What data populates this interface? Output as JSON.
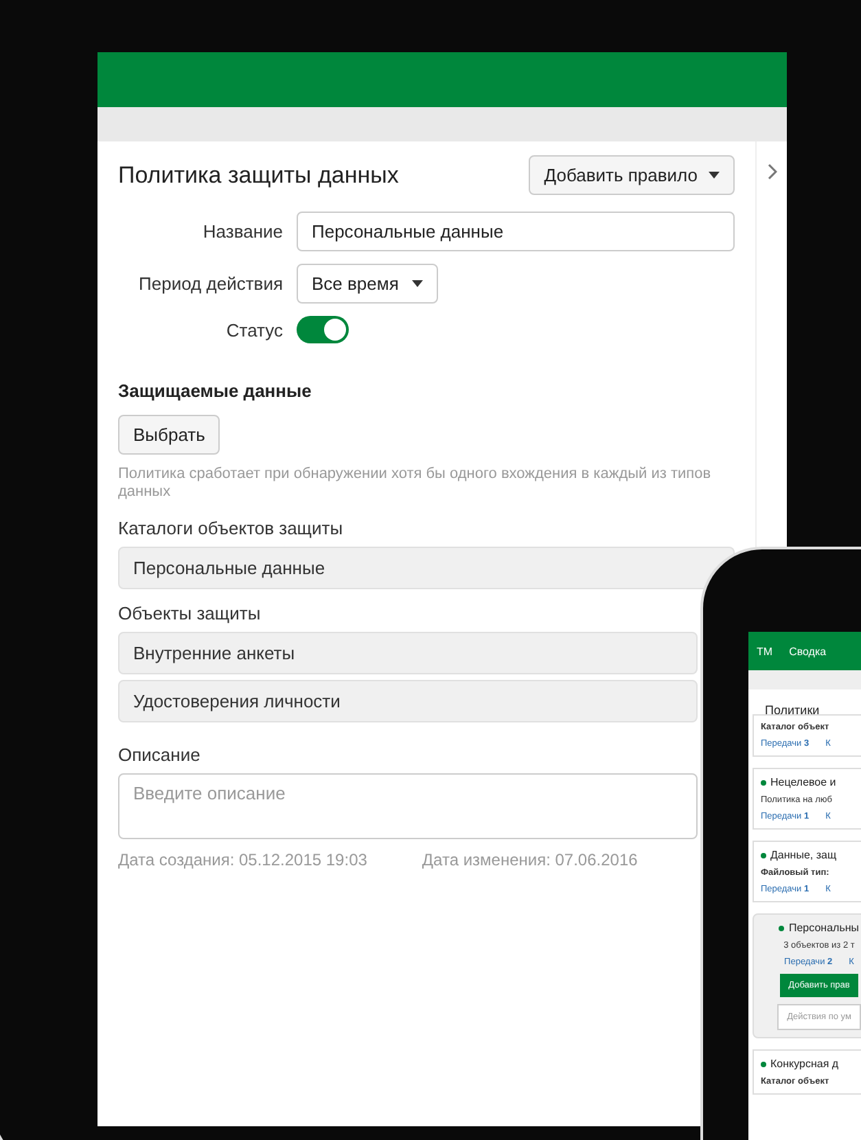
{
  "tablet": {
    "title": "Политика защиты данных",
    "add_rule_button": "Добавить правило",
    "fields": [
      {
        "kind": "input",
        "label": "Название",
        "value": "Персональные данные"
      },
      {
        "kind": "select",
        "label": "Период действия",
        "value": "Все время"
      },
      {
        "kind": "toggle",
        "label": "Статус",
        "on": true
      }
    ],
    "protected_heading": "Защищаемые данные",
    "choose_button": "Выбрать",
    "hint": "Политика сработает при обнаружении хотя бы одного вхождения в каждый из типов данных",
    "groups": [
      {
        "label": "Каталоги объектов защиты",
        "items": [
          "Персональные данные"
        ]
      },
      {
        "label": "Объекты защиты",
        "items": [
          "Внутренние анкеты",
          "Удостоверения личности"
        ]
      }
    ],
    "description_label": "Описание",
    "description_placeholder": "Введите описание",
    "created": "Дата создания: 05.12.2015 19:03",
    "modified": "Дата изменения: 07.06.2016"
  },
  "phone": {
    "logo": "ТМ",
    "nav_item": "Сводка",
    "title": "Политики",
    "cards": [
      {
        "detail": "Каталог объект",
        "detail_bold": true,
        "link": "Передачи **3**",
        "link2": "К",
        "selected": false
      },
      {
        "title": "Нецелевое и",
        "detail": "Политика на люб",
        "detail_bold": false,
        "link": "Передачи **1**",
        "link2": "К",
        "selected": false
      },
      {
        "title": "Данные, защ",
        "detail": "Файловый тип:",
        "detail_bold": true,
        "link": "Передачи **1**",
        "link2": "К",
        "selected": false
      },
      {
        "title": "Персональны",
        "detail": "3 объектов из 2 т",
        "detail_bold": false,
        "link": "Передачи **2**",
        "link2": "К",
        "selected": true,
        "button": "Добавить прав",
        "placeholder": "Действия по ум"
      },
      {
        "title": "Конкурсная д",
        "detail": "Каталог объект",
        "detail_bold": true,
        "selected": false
      }
    ]
  }
}
